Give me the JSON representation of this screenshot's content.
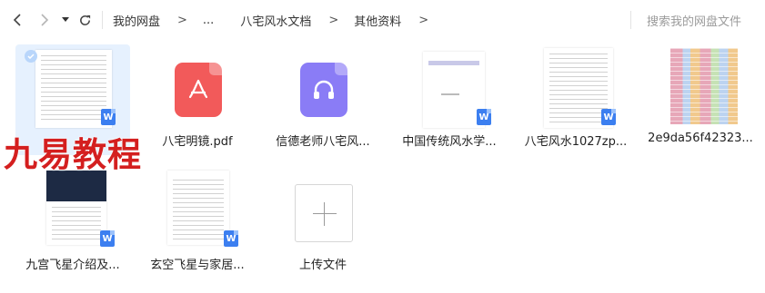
{
  "toolbar": {
    "back_icon": "chevron-left-icon",
    "forward_icon": "chevron-right-icon",
    "dropdown_icon": "caret-down-icon",
    "refresh_icon": "refresh-icon",
    "breadcrumb": [
      "我的网盘",
      "...",
      "八宅风水文档",
      "其他资料"
    ],
    "separator": ">",
    "search_placeholder": "搜索我的网盘文件"
  },
  "files": [
    {
      "name": "",
      "type": "docx",
      "selected": true
    },
    {
      "name": "八宅明镜.pdf",
      "type": "pdf"
    },
    {
      "name": "信德老师八宅风...",
      "type": "audio"
    },
    {
      "name": "中国传统风水学...",
      "type": "docx"
    },
    {
      "name": "八宅风水1027zp...",
      "type": "docx"
    },
    {
      "name": "2e9da56f42323...",
      "type": "image"
    },
    {
      "name": "九宫飞星介绍及...",
      "type": "docx"
    },
    {
      "name": "玄空飞星与家居...",
      "type": "docx"
    }
  ],
  "upload": {
    "label": "上传文件"
  },
  "watermark": {
    "text": "九易教程"
  },
  "colors": {
    "accent": "#3c7ff0",
    "pdf": "#f25a5a",
    "audio": "#8a7cf6",
    "selection": "#e6f1fe",
    "watermark": "#d41f1f"
  }
}
